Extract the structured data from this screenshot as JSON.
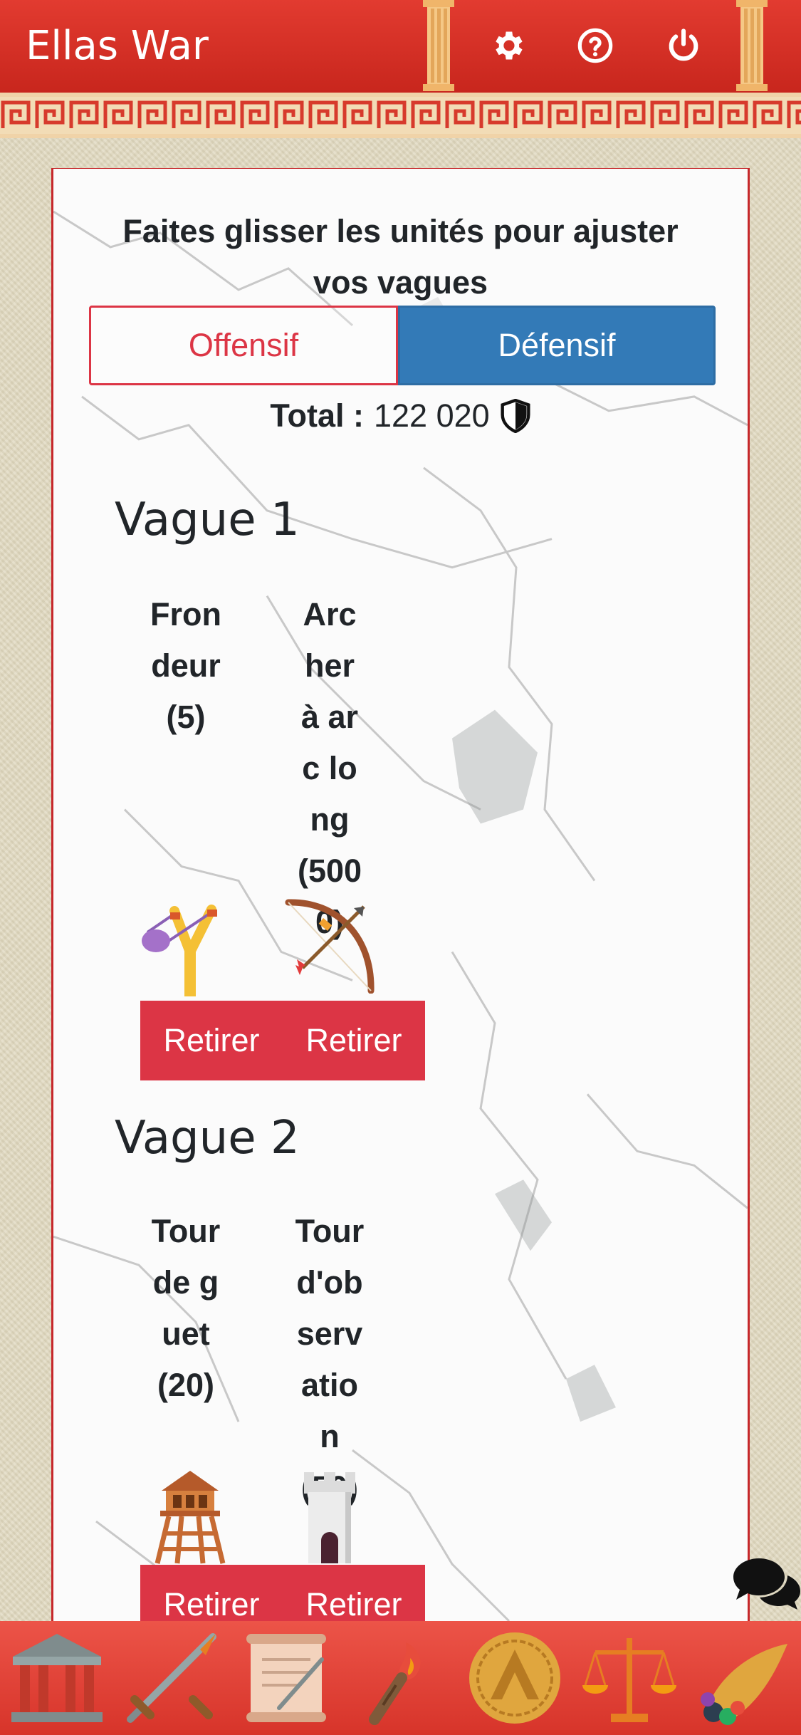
{
  "header": {
    "title": "Ellas War",
    "icons": [
      "gear-icon",
      "help-circle-icon",
      "power-icon"
    ]
  },
  "panel": {
    "instructions": "Faites glisser les unités pour ajuster vos vagues",
    "mode_toggle": {
      "offensive_label": "Offensif",
      "defensive_label": "Défensif",
      "selected": "Défensif"
    },
    "total": {
      "label": "Total :",
      "value": "122 020",
      "icon": "shield-icon"
    },
    "waves": [
      {
        "title": "Vague 1",
        "units": [
          {
            "name": "Frondeur",
            "count": "(5)",
            "icon": "slingshot-icon",
            "remove_label": "Retirer"
          },
          {
            "name": "Archer à arc long",
            "count": "(5000)",
            "icon": "longbow-icon",
            "remove_label": "Retirer"
          }
        ]
      },
      {
        "title": "Vague 2",
        "units": [
          {
            "name": "Tour de guet",
            "count": "(20)",
            "icon": "watchtower-icon",
            "remove_label": "Retirer"
          },
          {
            "name": "Tour d'observation",
            "count": "(50)",
            "icon": "stone-tower-icon",
            "remove_label": "Retirer"
          }
        ]
      }
    ]
  },
  "chat": {
    "icon": "chat-bubbles-icon"
  },
  "bottom_nav": {
    "items": [
      "temple-icon",
      "crossed-swords-icon",
      "scroll-quill-icon",
      "torch-icon",
      "spartan-shield-icon",
      "scales-icon",
      "cornucopia-icon"
    ]
  },
  "colors": {
    "header_red": "#d32f25",
    "danger_red": "#dc3545",
    "primary_blue": "#337ab7",
    "sand_background": "#e0d8be"
  }
}
